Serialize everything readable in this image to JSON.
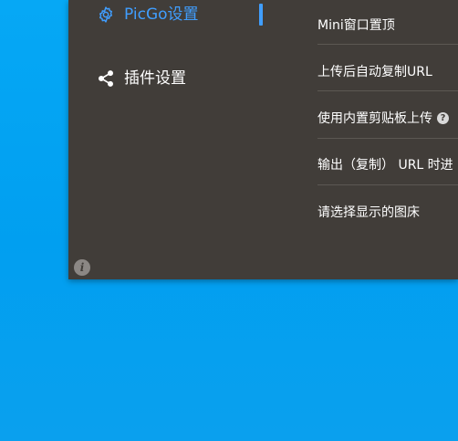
{
  "sidebar": {
    "items": [
      {
        "label": "PicGo设置",
        "icon": "gear-icon",
        "active": true
      },
      {
        "label": "插件设置",
        "icon": "share-icon",
        "active": false
      }
    ],
    "accent_color": "#409eff"
  },
  "settings": {
    "rows": [
      {
        "label": "Mini窗口置顶"
      },
      {
        "label": "上传后自动复制URL"
      },
      {
        "label": "使用内置剪贴板上传",
        "help_icon": "question-icon",
        "help_glyph": "?"
      },
      {
        "label": "输出（复制） URL 时进"
      },
      {
        "label": "请选择显示的图床"
      }
    ]
  },
  "footer": {
    "info_icon": "info-icon",
    "info_glyph": "i"
  },
  "colors": {
    "window_bg": "#413d39",
    "desktop_bg": "#01a0ef",
    "text": "#ffffff"
  }
}
